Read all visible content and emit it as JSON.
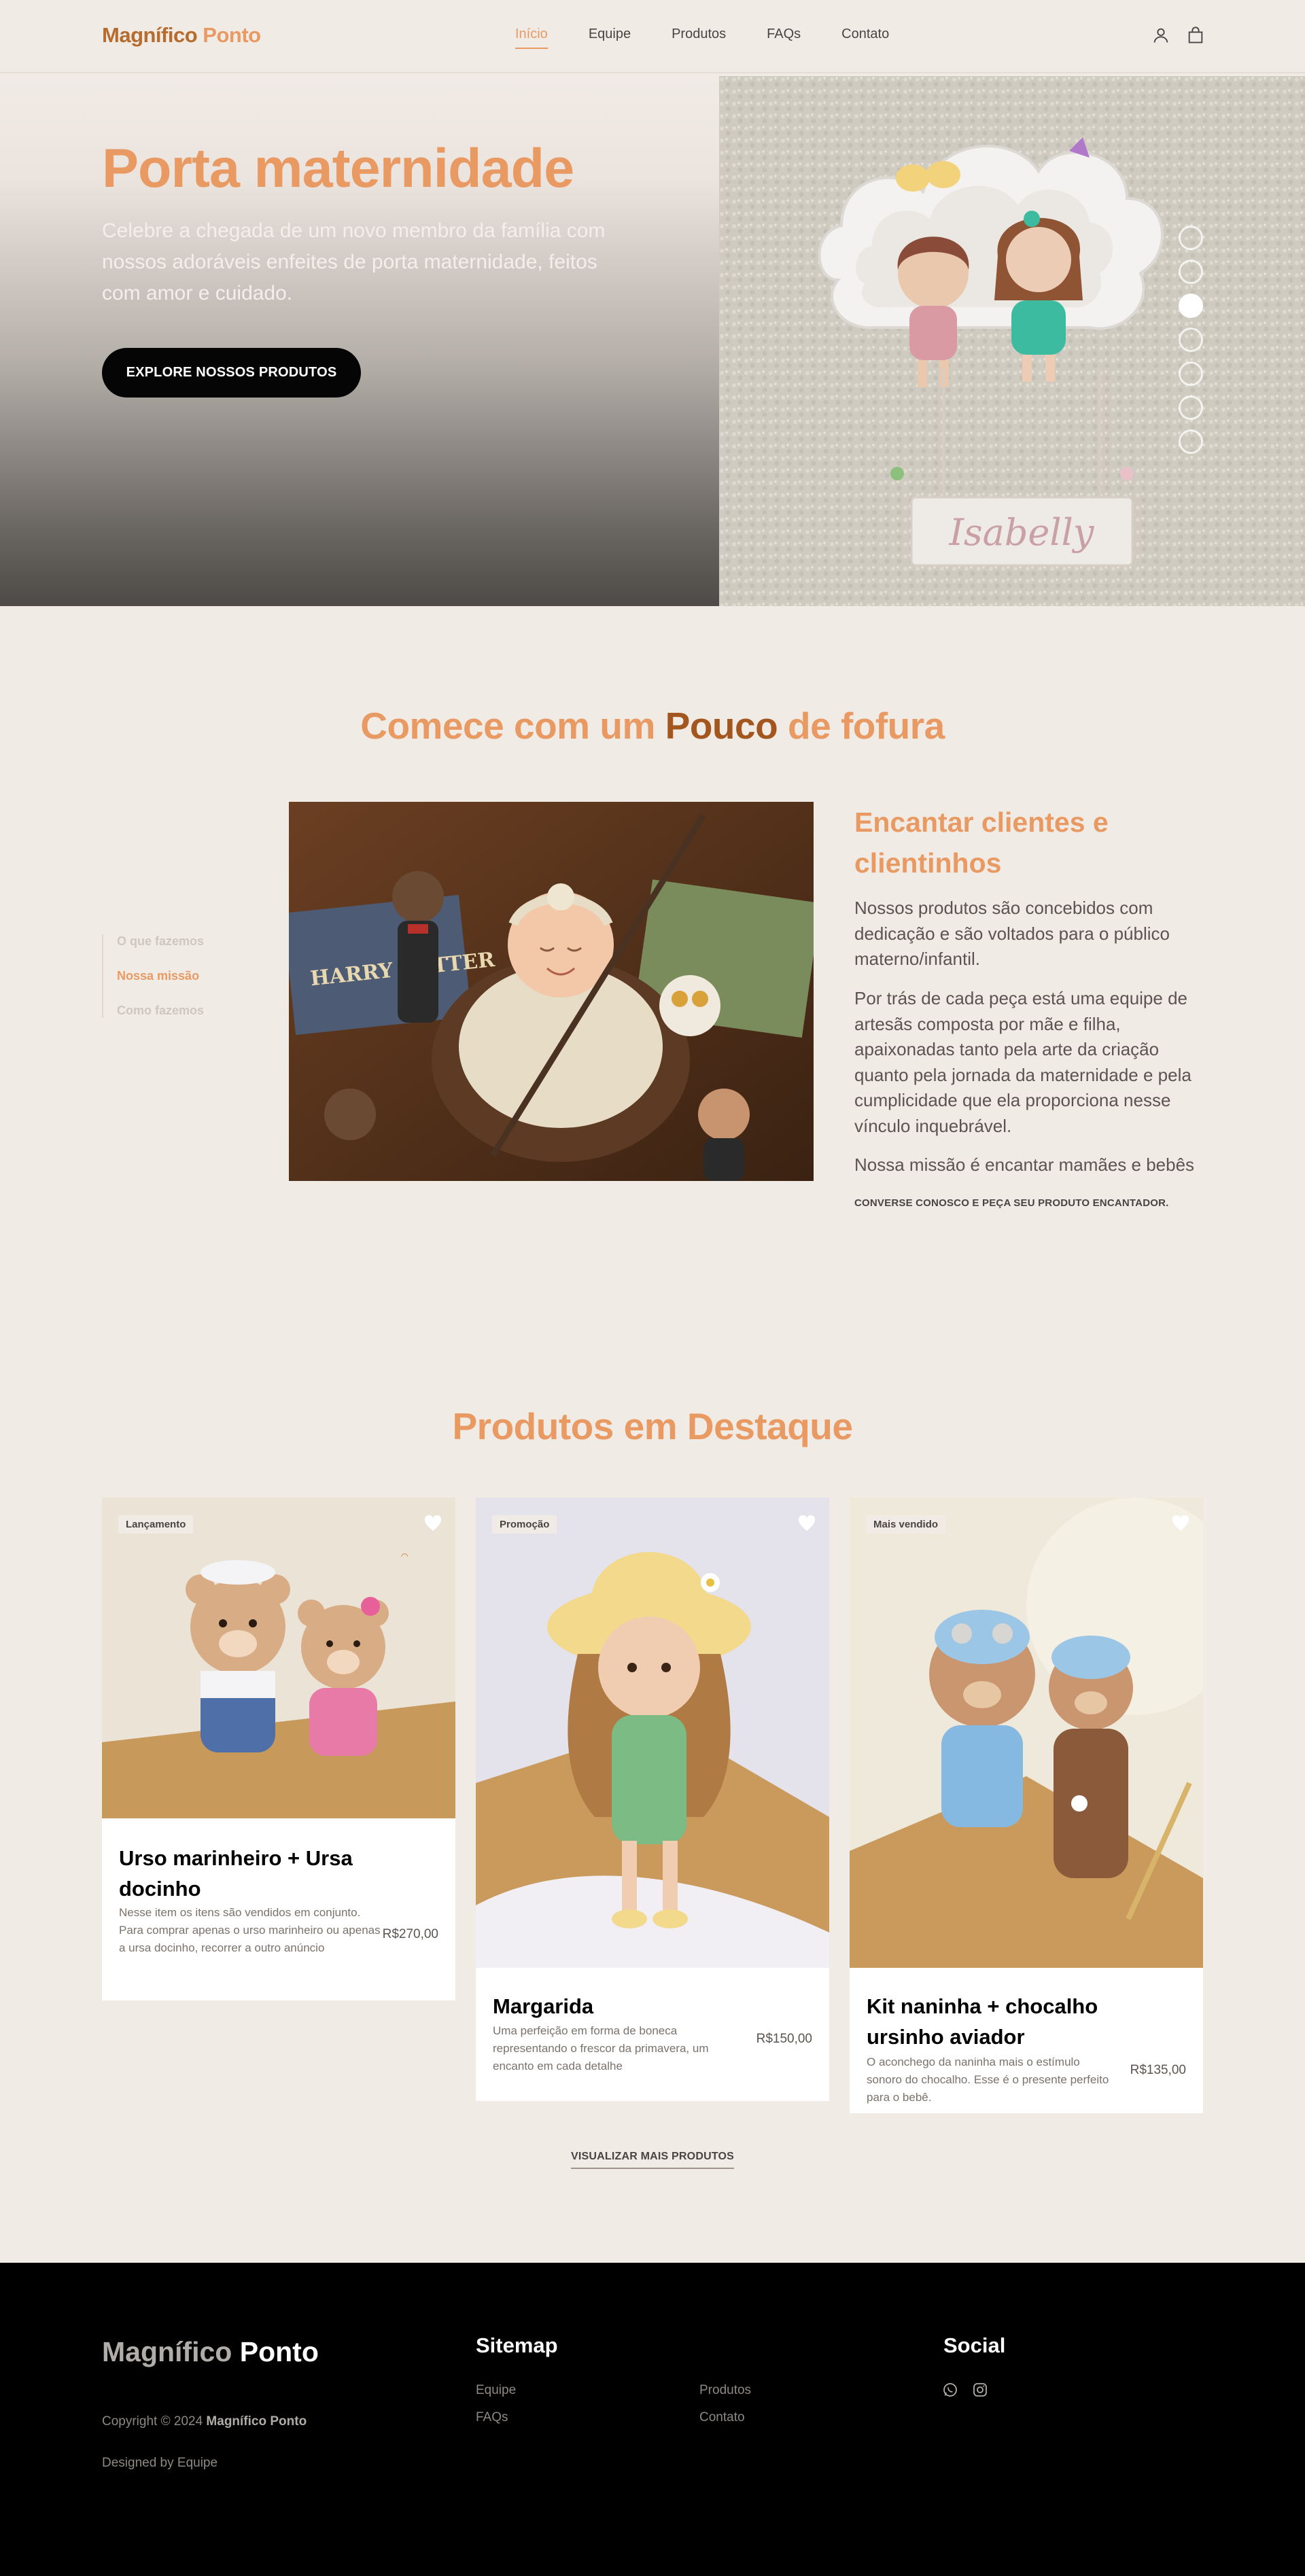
{
  "nav": {
    "brand_part1": "Magnífico",
    "brand_part2": "Ponto",
    "links": [
      "Início",
      "Equipe",
      "Produtos",
      "FAQs",
      "Contato"
    ],
    "active_link": "Início",
    "icons": [
      "user-icon",
      "shopping-bag-icon"
    ]
  },
  "hero": {
    "title": "Porta maternidade",
    "subtitle": "Celebre a chegada de um novo membro da família com nossos adoráveis enfeites de porta maternidade, feitos com amor e cuidado.",
    "button": "EXPLORE NOSSOS PRODUTOS",
    "image_text": "Isabelly",
    "slides_count": 7,
    "active_slide": 3
  },
  "about": {
    "title_part1": "Comece com um",
    "title_highlight": "Pouco",
    "title_part2": "de fofura",
    "side_nav": [
      "O que fazemos",
      "Nossa missão",
      "Como fazemos"
    ],
    "active_side": "Nossa missão",
    "image_text": "HARRY POTTER",
    "heading": "Encantar clientes e clientinhos",
    "paragraph1": "Nossos produtos são concebidos com dedicação e são voltados para o público materno/infantil.",
    "paragraph2": "Por trás de cada peça está uma equipe de artesãs composta por mãe e filha, apaixonadas tanto pela arte da criação quanto pela jornada da maternidade e pela cumplicidade que ela proporciona nesse vínculo inquebrável.",
    "paragraph3": "Nossa missão é encantar mamães e bebês",
    "cta": "CONVERSE CONOSCO E PEÇA SEU PRODUTO ENCANTADOR."
  },
  "products": {
    "title": "Produtos em Destaque",
    "items": [
      {
        "badge": "Lançamento",
        "name": "Urso marinheiro + Ursa docinho",
        "description": "Nesse item os itens são vendidos em conjunto. Para comprar apenas o urso marinheiro ou apenas a ursa docinho, recorrer a outro anúncio",
        "price": "R$270,00"
      },
      {
        "badge": "Promoção",
        "name": "Margarida",
        "description": "Uma perfeição em forma de boneca representando o frescor da primavera, um encanto em cada detalhe",
        "price": "R$150,00"
      },
      {
        "badge": "Mais vendido",
        "name": "Kit naninha + chocalho ursinho aviador",
        "description": "O aconchego da naninha mais o estímulo sonoro do chocalho. Esse é o presente perfeito para o bebê.",
        "price": "R$135,00"
      }
    ],
    "more_link": "VISUALIZAR MAIS PRODUTOS"
  },
  "footer": {
    "brand_part1": "Magnífico",
    "brand_part2": "Ponto",
    "copyright_prefix": "Copyright © 2024",
    "copyright_brand": "Magnífico Ponto",
    "designed_by": "Designed by Equipe",
    "sitemap_title": "Sitemap",
    "sitemap_links": [
      "Equipe",
      "Produtos",
      "FAQs",
      "Contato"
    ],
    "social_title": "Social",
    "social_icons": [
      "whatsapp-icon",
      "instagram-icon"
    ]
  },
  "colors": {
    "background": "#f1ebe6",
    "accent": "#e99a63",
    "accent_dark": "#a3571f",
    "footer_bg": "#000000"
  }
}
